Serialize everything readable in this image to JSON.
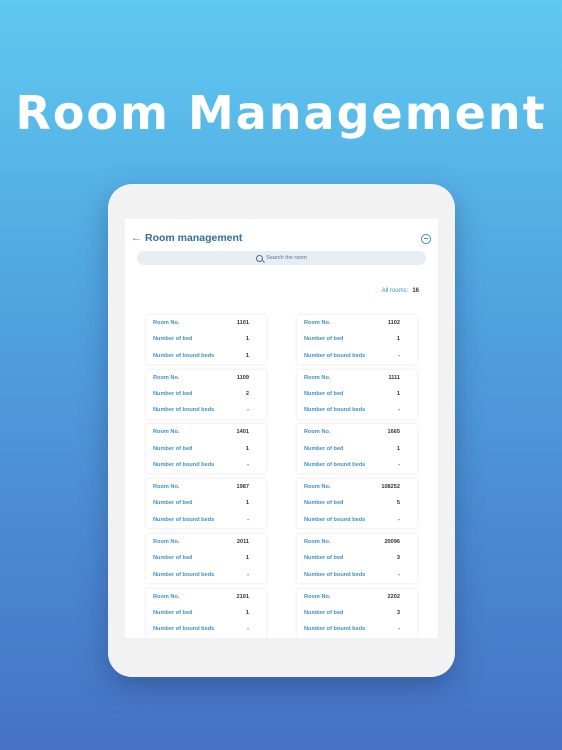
{
  "hero": {
    "title": "Room Management"
  },
  "header": {
    "title": "Room management",
    "back_icon": "back-arrow-icon",
    "exit_icon": "exit-icon"
  },
  "search": {
    "placeholder": "Search the room",
    "icon": "search-icon"
  },
  "summary": {
    "label": "All rooms:",
    "count": "16"
  },
  "labels": {
    "room_no": "Room No.",
    "num_bed": "Number of bed",
    "num_bound": "Number of bound beds"
  },
  "rooms": [
    {
      "room_no": "1101",
      "beds": "1",
      "bound": "1"
    },
    {
      "room_no": "1102",
      "beds": "1",
      "bound": "-"
    },
    {
      "room_no": "1109",
      "beds": "2",
      "bound": "-"
    },
    {
      "room_no": "1111",
      "beds": "1",
      "bound": "-"
    },
    {
      "room_no": "1401",
      "beds": "1",
      "bound": "-"
    },
    {
      "room_no": "1665",
      "beds": "1",
      "bound": "-"
    },
    {
      "room_no": "1987",
      "beds": "1",
      "bound": "-"
    },
    {
      "room_no": "108252",
      "beds": "5",
      "bound": "-"
    },
    {
      "room_no": "2011",
      "beds": "1",
      "bound": "-"
    },
    {
      "room_no": "20096",
      "beds": "3",
      "bound": "-"
    },
    {
      "room_no": "2101",
      "beds": "1",
      "bound": "-"
    },
    {
      "room_no": "2202",
      "beds": "3",
      "bound": "-"
    }
  ]
}
